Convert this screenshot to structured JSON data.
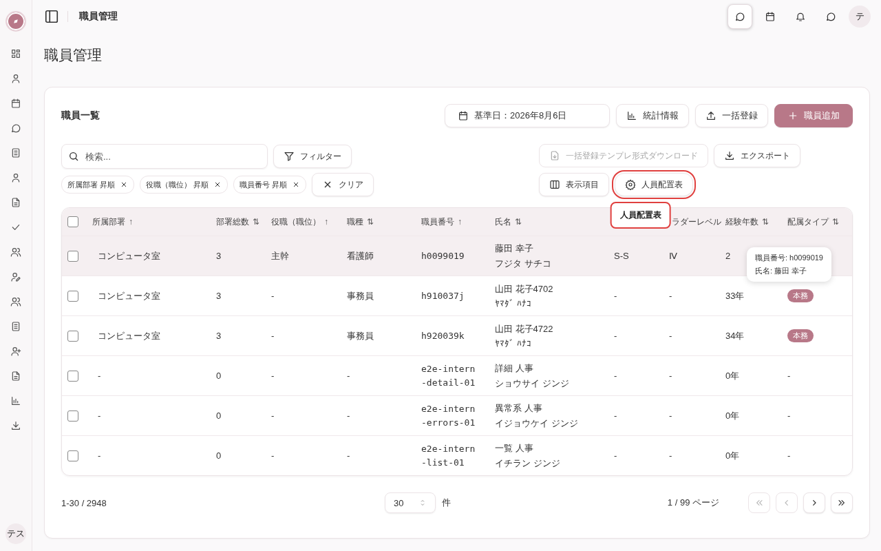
{
  "topbar": {
    "title": "職員管理",
    "icons": [
      {
        "kind": "chat",
        "selected": true
      },
      {
        "kind": "calendar",
        "selected": false
      },
      {
        "kind": "bell",
        "selected": false
      },
      {
        "kind": "message",
        "selected": false
      }
    ],
    "avatar": "テ"
  },
  "sidebar": {
    "avatar": "テス"
  },
  "page_title": "職員管理",
  "card": {
    "title": "職員一覧",
    "actions": [
      {
        "kind": "date",
        "label": "基準日：2026年8月6日"
      },
      {
        "kind": "stats",
        "label": "統計情報"
      },
      {
        "kind": "upload",
        "label": "一括登録"
      },
      {
        "kind": "primary",
        "label": "職員追加"
      }
    ],
    "search": {
      "placeholder": "検索..."
    },
    "filter_button": "フィルター",
    "tools": [
      {
        "kind": "template",
        "label": "一括登録テンプレ形式ダウンロード",
        "disabled": true
      },
      {
        "kind": "export",
        "label": "エクスポート",
        "disabled": false
      }
    ],
    "view_buttons": [
      {
        "kind": "columns",
        "label": "表示項目",
        "highlighted": false
      },
      {
        "kind": "settings",
        "label": "人員配置表",
        "highlighted": true
      }
    ],
    "tooltip": "人員配置表",
    "chips": [
      "所属部署 昇順",
      "役職（職位） 昇順",
      "職員番号 昇順"
    ],
    "clear_button": "クリア"
  },
  "table": {
    "select_all_checked": false,
    "columns": [
      {
        "label": "所属部署",
        "sort_icon": "↑"
      },
      {
        "label": "部署総数",
        "sort_icon": "⇅"
      },
      {
        "label": "役職（職位）",
        "sort_icon": "↑"
      },
      {
        "label": "職種",
        "sort_icon": "⇅"
      },
      {
        "label": "職員番号",
        "sort_icon": "↑"
      },
      {
        "label": "氏名",
        "sort_icon": "⇅"
      },
      {},
      {
        "label": "ラダーレベル"
      },
      {
        "label": "経験年数",
        "sort_icon": "⇅"
      },
      {
        "label": "配属タイプ",
        "sort_icon": "⇅"
      }
    ],
    "rows": [
      {
        "checked": false,
        "highlighted": true,
        "dept": "コンピュータ室",
        "count": "3",
        "position": "主幹",
        "job": "看護師",
        "staff_no": "h0099019",
        "name": "藤田 幸子",
        "kana": "フジタ サチコ",
        "grade": "S-S",
        "ladder": "Ⅳ",
        "years": "2"
      },
      {
        "checked": false,
        "highlighted": false,
        "dept": "コンピュータ室",
        "count": "3",
        "position": "-",
        "job": "事務員",
        "staff_no": "h910037j",
        "name": "山田 花子4702",
        "kana": "ﾔﾏﾀﾞ ﾊﾅｺ",
        "grade": "-",
        "ladder": "-",
        "years": "33年",
        "assignment": {
          "kind": "badge",
          "label": "本務"
        }
      },
      {
        "checked": false,
        "highlighted": false,
        "dept": "コンピュータ室",
        "count": "3",
        "position": "-",
        "job": "事務員",
        "staff_no": "h920039k",
        "name": "山田 花子4722",
        "kana": "ﾔﾏﾀﾞ ﾊﾅｺ",
        "grade": "-",
        "ladder": "-",
        "years": "34年",
        "assignment": {
          "kind": "badge",
          "label": "本務"
        }
      },
      {
        "checked": false,
        "highlighted": false,
        "dept": "-",
        "count": "0",
        "position": "-",
        "job": "-",
        "staff_no": "e2e-intern-detail-01",
        "name": "詳細 人事",
        "kana": "ショウサイ ジンジ",
        "grade": "-",
        "ladder": "-",
        "years": "0年",
        "assignment": {
          "kind": "text",
          "label": "-"
        }
      },
      {
        "checked": false,
        "highlighted": false,
        "dept": "-",
        "count": "0",
        "position": "-",
        "job": "-",
        "staff_no": "e2e-intern-errors-01",
        "name": "異常系 人事",
        "kana": "イジョウケイ ジンジ",
        "grade": "-",
        "ladder": "-",
        "years": "0年",
        "assignment": {
          "kind": "text",
          "label": "-"
        }
      },
      {
        "checked": false,
        "highlighted": false,
        "dept": "-",
        "count": "0",
        "position": "-",
        "job": "-",
        "staff_no": "e2e-intern-list-01",
        "name": "一覧 人事",
        "kana": "イチラン ジンジ",
        "grade": "-",
        "ladder": "-",
        "years": "0年",
        "assignment": {
          "kind": "text",
          "label": "-"
        }
      }
    ],
    "row_tooltip": [
      "職員番号: h0099019",
      "氏名: 藤田 幸子"
    ]
  },
  "footer": {
    "range": "1-30 / 2948",
    "page_size": "30",
    "page_size_unit": "件",
    "page_info": "1 / 99 ページ",
    "pager": [
      {
        "kind": "first",
        "disabled": true
      },
      {
        "kind": "prev",
        "disabled": true
      },
      {
        "kind": "next",
        "disabled": false
      },
      {
        "kind": "last",
        "disabled": false
      }
    ]
  }
}
